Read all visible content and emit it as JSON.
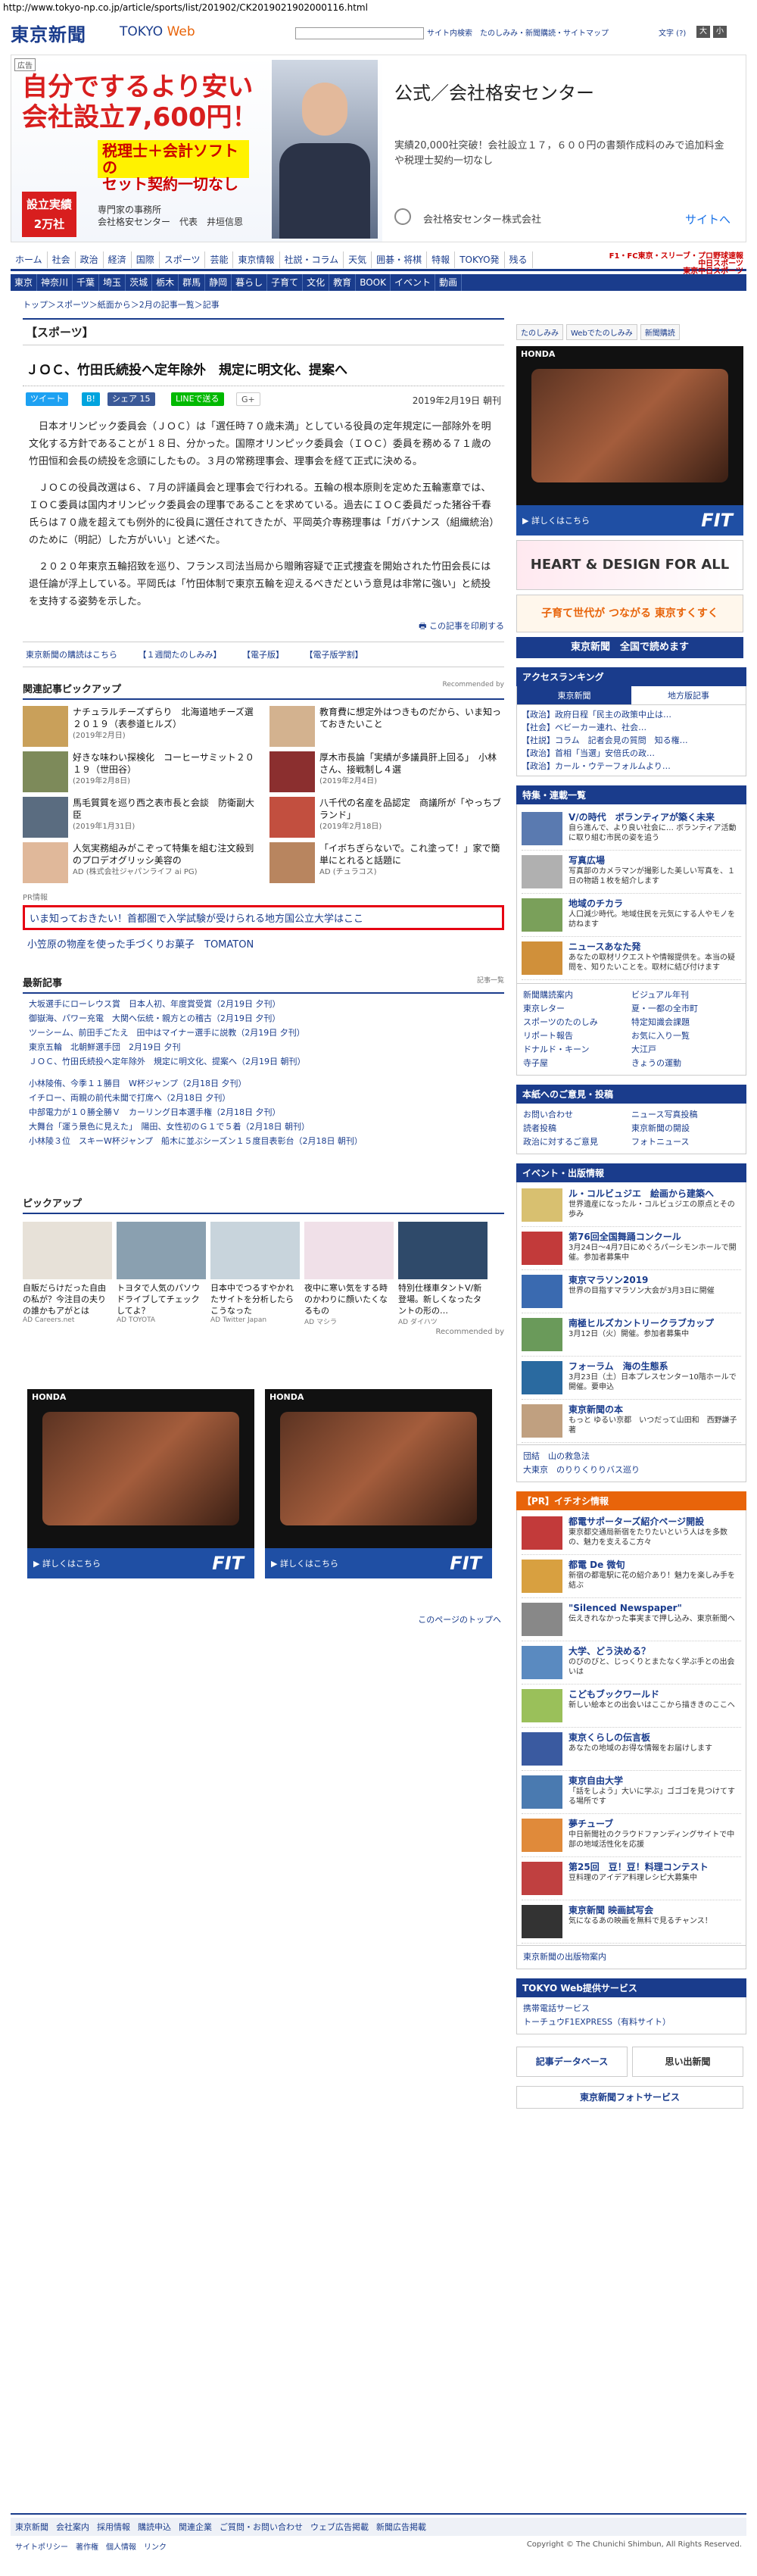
{
  "url": "http://www.tokyo-np.co.jp/article/sports/list/201902/CK2019021902000116.html",
  "header": {
    "logo": "東京新聞",
    "brand_tokyo": "TOKYO",
    "brand_web": "Web",
    "search_btn": "サイト内検索",
    "links": "たのしみみ・新聞購読・サイトマップ",
    "fontsize": "文字 (?)",
    "fs_big": "大",
    "fs_small": "小"
  },
  "ad": {
    "tag": "広告",
    "h1": "自分でするより安い",
    "h2": "会社設立7,600円！",
    "box": "税理士＋会計ソフトの\nセット契約一切なし",
    "badge": "設立実績\n2万社",
    "sub": "専門家の事務所\n会社格安センター　代表　井垣信恩",
    "title": "公式／会社格安センター",
    "text": "実績20,000社突破！会社設立１７，６００円の書類作成料のみで追加料金や税理士契約一切なし",
    "company": "会社格安センター株式会社",
    "link": "サイトへ"
  },
  "nav1": [
    "ホーム",
    "社会",
    "政治",
    "経済",
    "国際",
    "スポーツ",
    "芸能",
    "東京情報",
    "社説・コラム",
    "天気",
    "囲碁・将棋",
    "特報",
    "TOKYO発",
    "残る"
  ],
  "nav1_ed": "F1・FC東京・スリーブ・プロ野球速報\n中日スポーツ\n東京中日スポーツ",
  "nav2": [
    "東京",
    "神奈川",
    "千葉",
    "埼玉",
    "茨城",
    "栃木",
    "群馬",
    "静岡",
    "暮らし",
    "子育て",
    "文化",
    "教育",
    "BOOK",
    "イベント",
    "動画"
  ],
  "crumb": "トップ＞スポーツ＞紙面から＞2月の記事一覧＞記事",
  "section": "【スポーツ】",
  "title": "ＪＯＣ、竹田氏続投へ定年除外　規定に明文化、提案へ",
  "share": {
    "tweet": "ツイート",
    "b": "B!",
    "fb": "シェア 15",
    "line": "LINEで送る",
    "g": "G+"
  },
  "date": "2019年2月19日 朝刊",
  "body": [
    "日本オリンピック委員会（ＪＯＣ）は「選任時７０歳未満」としている役員の定年規定に一部除外を明文化する方針であることが１８日、分かった。国際オリンピック委員会（ＩＯＣ）委員を務める７１歳の竹田恒和会長の続投を念頭にしたもの。３月の常務理事会、理事会を経て正式に決める。",
    "ＪＯＣの役員改選は６、７月の評議員会と理事会で行われる。五輪の根本原則を定めた五輪憲章では、ＩＯＣ委員は国内オリンピック委員会の理事であることを求めている。過去にＩＯＣ委員だった猪谷千春氏らは７０歳を超えても例外的に役員に選任されてきたが、平岡英介専務理事は「ガバナンス（組織統治）のために（明記）した方がいい」と述べた。",
    "２０２０年東京五輪招致を巡り、フランス司法当局から贈賄容疑で正式捜査を開始された竹田会長には退任論が浮上している。平岡氏は「竹田体制で東京五輪を迎えるべきだという意見は非常に強い」と続投を支持する姿勢を示した。"
  ],
  "print": "この記事を印刷する",
  "links": [
    "東京新聞の購読はこちら",
    "【１週間たのしみみ】",
    "【電子版】",
    "【電子版学割】"
  ],
  "related": {
    "title": "関連記事ピックアップ",
    "rec": "Recommended by",
    "items": [
      {
        "t": "ナチュラルチーズずらり　北海道地チーズ選２０１９（表参道ヒルズ）",
        "s": "(2019年2月日)"
      },
      {
        "t": "教育費に想定外はつきものだから、いま知っておきたいこと",
        "s": ""
      },
      {
        "t": "好きな味わい探検化　コーヒーサミット２０１９（世田谷）",
        "s": "(2019年2月8日)"
      },
      {
        "t": "厚木市長論「実績が多議員肝上回る」　小林さん、接戦制し４選",
        "s": "(2019年2月4日)"
      },
      {
        "t": "馬毛質質を巡り西之表市長と会談　防衛副大臣",
        "s": "(2019年1月31日)"
      },
      {
        "t": "八千代の名産を品認定　商議所が「やっちブランド」",
        "s": "(2019年2月18日)"
      },
      {
        "t": "人気実務組みがこぞって特集を組む注文殺到のプロデオグリッシ美容の",
        "s": "AD (株式会社ジャパンライフ ai PG)"
      },
      {
        "t": "「イボちぎらないで。これ塗って！」家で簡単にとれると話題に",
        "s": "AD (チュラコス)"
      }
    ]
  },
  "pr": {
    "label": "PR情報",
    "red": "いま知っておきたい！首都圏で入学試験が受けられる地方国公立大学はここ",
    "link": "小笠原の物産を使った手づくりお菓子　TOMATON"
  },
  "latest": {
    "title": "最新記事",
    "more": "記事一覧",
    "g1": [
      "大坂選手にローレウス賞　日本人初、年度賞受賞（2月19日 夕刊）",
      "御嶽海、パワー充電　大関へ伝統・親方との稽古（2月19日 夕刊）",
      "ツーシーム、前田手ごたえ　田中はマイナー選手に説教（2月19日 夕刊）",
      "東京五輪　北朝鮮選手団　2月19日 夕刊",
      "ＪＯＣ、竹田氏続投へ定年除外　規定に明文化、提案へ（2月19日 朝刊）"
    ],
    "g2": [
      "小林陵侑、今季１１勝目　W杯ジャンプ（2月18日 夕刊）",
      "イチロー、両親の前代未聞で打席へ（2月18日 夕刊）",
      "中部電力が１０勝全勝Ｖ　カーリング日本選手権（2月18日 夕刊）",
      "大舞台「運う景色に見えた」　陽田、女性初のＧ１で５着（2月18日 朝刊）",
      "小林陵３位　スキーW杯ジャンプ　船木に並ぶシーズン１５度目表彰台（2月18日 朝刊）"
    ]
  },
  "pickup": {
    "title": "ピックアップ",
    "items": [
      {
        "t": "自販だらけだった自由の私が？今注目の夫りの誰かもアがとは",
        "s": "AD Careers.net"
      },
      {
        "t": "トヨタで人気のパソウドライブしてチェックしてよ？",
        "s": "AD TOYOTA"
      },
      {
        "t": "日本中でつるすやかれたサイトを分析したらこうなった",
        "s": "AD Twitter Japan"
      },
      {
        "t": "夜中に寒い気をする時のかわりに顔いたくなるもの",
        "s": "AD マシラ"
      },
      {
        "t": "特別仕様車タントV/新登場。新しくなったタントの形の…",
        "s": "AD ダイハツ"
      }
    ],
    "rec": "Recommended by"
  },
  "honda": {
    "brand": "HONDA",
    "detail": "▶ 詳しくはこちら",
    "model": "FIT"
  },
  "totop": "このページのトップへ",
  "side": {
    "tabs": [
      "たのしみみ",
      "Webでたのしみみ",
      "新聞購読"
    ],
    "heart": "HEART & DESIGN FOR ALL",
    "sukusuku": "子育て世代が つながる 東京すくすく",
    "paper": "東京新聞　全国で読めます",
    "rank_title": "アクセスランキング",
    "rank_tabs": [
      "東京新聞",
      "地方版記事"
    ],
    "rank": [
      "【政治】政府日程「民主の政策中止は…",
      "【社会】ベビーカー連れ、社会…",
      "【社説】コラム　記者会見の質問　知る権…",
      "【政治】首相「当選」安倍氏の政…",
      "【政治】カール・ウテーフォルムより…"
    ],
    "feat_title": "特集・連載一覧",
    "feat": [
      {
        "t": "V/の時代　ボランティアが築く未来",
        "s": "自ら進んで、より良い社会に… ボランティア活動に取り組む市民の姿を追う"
      },
      {
        "t": "写真広場",
        "s": "写真部のカメラマンが撮影した美しい写真を、１日の物語１枚を紹介します"
      },
      {
        "t": "地域のチカラ",
        "s": "人口減少時代。地域住民を元気にする人やモノを訪ねます"
      },
      {
        "t": "ニュースあなた発",
        "s": "あなたの取材リクエストや情報提供を。本当の疑問を、知りたいことを。取材に結び付けます"
      }
    ],
    "g2": [
      "新聞購読案内",
      "ビジュアル年刊",
      "東京レター",
      "夏・一都の全市町",
      "スポーツのたのしみ",
      "特定知識会課題",
      "リポート報告",
      "お気に入り一覧",
      "ドナルド・キーン",
      "大江戸",
      "寺子屋",
      "きょうの運動"
    ],
    "opinion_title": "本紙へのご意見・投稿",
    "opinion": [
      "お問い合わせ",
      "ニュース写真投稿",
      "読者投稿",
      "東京新聞の開設",
      "政治に対するご意見",
      "フォトニュース"
    ],
    "event_title": "イベント・出版情報",
    "events": [
      {
        "t": "ル・コルビュジエ　絵画から建築へ",
        "s": "世界遺産になったル・コルビュジエの原点とその歩み"
      },
      {
        "t": "第76回全国舞踊コンクール",
        "s": "3月24日〜4月7日にめぐろパーシモンホールで開催。参加者募集中"
      },
      {
        "t": "東京マラソン2019",
        "s": "世界の目指すマラソン大会が3月3日に開催"
      },
      {
        "t": "南極ヒルズカントリークラブカップ",
        "s": "3月12日（火）開催。参加者募集中"
      },
      {
        "t": "フォーラム　海の生態系",
        "s": "3月23日（土）日本プレスセンター10階ホールで開催。要申込"
      },
      {
        "t": "東京新聞の本",
        "s": "もっと ゆるい京都　いつだって山田和　西野謙子　著"
      }
    ],
    "more": [
      "団結　山の救急法",
      "大東京　のりりくりりバス巡り"
    ],
    "pr_title": "【PR】イチオシ情報",
    "pr": [
      {
        "t": "都電サポーターズ紹介ページ開設",
        "s": "東京都交通局新宿をたりたいという人はを多数の、魅力を支えるこ方々"
      },
      {
        "t": "都電 De 微旬",
        "s": "新宿の都電駅に花の紹介あり！魅力を楽しみ手を結ぶ"
      },
      {
        "t": "\"Silenced Newspaper\"",
        "s": "伝えきれなかった事実まで押し込み、東京新聞へ"
      },
      {
        "t": "大学、どう決める？",
        "s": "のびのびと、じっくりとまたなく学ぶ手との出会いは"
      },
      {
        "t": "こどもブックワールド",
        "s": "新しい絵本との出会いはここから描ききのここへ"
      },
      {
        "t": "東京くらしの伝言板",
        "s": "あなたの地域のお得な情報をお届けします"
      },
      {
        "t": "東京自由大学",
        "s": "「話をしよう」大いに学ぶ」ゴゴゴを見つけてする場所です"
      },
      {
        "t": "夢チューブ",
        "s": "中日新聞社のクラウドファンディングサイトで中部の地域活性化を応援"
      },
      {
        "t": "第25回　豆！豆！料理コンテスト",
        "s": "豆料理のアイデア料理レシピ大募集中"
      },
      {
        "t": "東京新聞 映画試写会",
        "s": "気になるあの映画を無料で見るチャンス！"
      }
    ],
    "pub": "東京新聞の出版物案内",
    "web_title": "TOKYO Web提供サービス",
    "web": [
      "携帯電話サービス",
      "トーチュウF1EXPRESS（有料サイト）"
    ],
    "db": "記事データベース",
    "omoide": "思い出新聞",
    "foto": "東京新聞フォトサービス"
  },
  "footer": {
    "l1": [
      "東京新聞",
      "会社案内",
      "採用情報",
      "購読申込",
      "関連企業",
      "ご質問・お問い合わせ",
      "ウェブ広告掲載",
      "新聞広告掲載"
    ],
    "l2": [
      "サイトポリシー",
      "著作権",
      "個人情報",
      "リンク"
    ],
    "copy": "Copyright © The Chunichi Shimbun, All Rights Reserved."
  },
  "colors": {
    "brand": "#1a3c8c",
    "red": "#e60012"
  }
}
